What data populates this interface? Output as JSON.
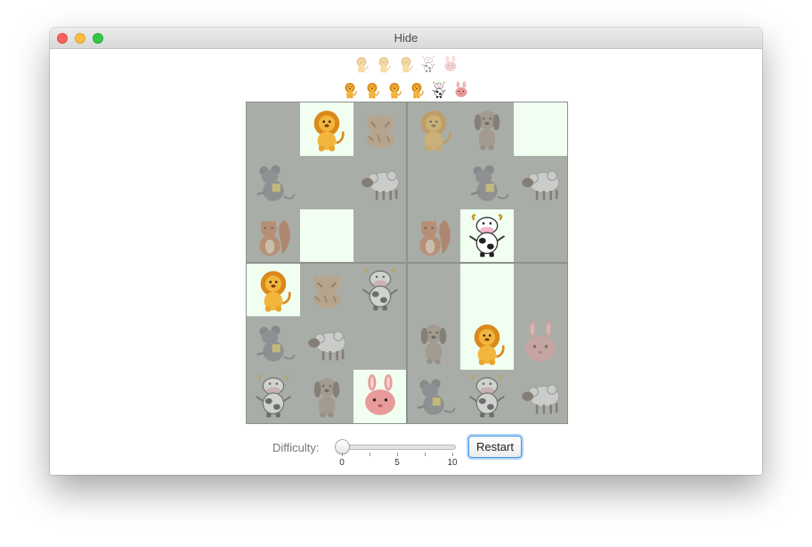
{
  "window": {
    "title": "Hide"
  },
  "tray_found": [
    "lion",
    "lion",
    "lion",
    "cow",
    "rabbit"
  ],
  "tray_targets": [
    "lion",
    "lion",
    "lion",
    "lion",
    "cow",
    "rabbit"
  ],
  "board": {
    "cells": [
      [
        "empty",
        "lion",
        "cat",
        "lion",
        "dog",
        "empty"
      ],
      [
        "mouse",
        "empty",
        "sheep",
        "empty",
        "mouse",
        "sheep"
      ],
      [
        "squirrel",
        "empty",
        "empty",
        "squirrel",
        "cow",
        "empty"
      ],
      [
        "lion",
        "cat",
        "cow",
        "empty",
        "empty",
        "empty"
      ],
      [
        "mouse",
        "sheep",
        "empty",
        "dog",
        "lion",
        "rabbit"
      ],
      [
        "cow",
        "dog",
        "rabbit",
        "mouse",
        "cow",
        "sheep"
      ]
    ],
    "lit": [
      [
        0,
        1,
        0,
        0,
        0,
        1
      ],
      [
        0,
        0,
        0,
        0,
        0,
        0
      ],
      [
        0,
        1,
        0,
        0,
        1,
        0
      ],
      [
        1,
        0,
        0,
        0,
        1,
        0
      ],
      [
        0,
        0,
        0,
        0,
        1,
        0
      ],
      [
        0,
        0,
        1,
        0,
        0,
        0
      ]
    ]
  },
  "controls": {
    "difficulty_label": "Difficulty:",
    "difficulty_value": 0,
    "difficulty_min": 0,
    "difficulty_max": 10,
    "tick_labels": [
      "0",
      "5",
      "10"
    ],
    "restart_label": "Restart"
  }
}
